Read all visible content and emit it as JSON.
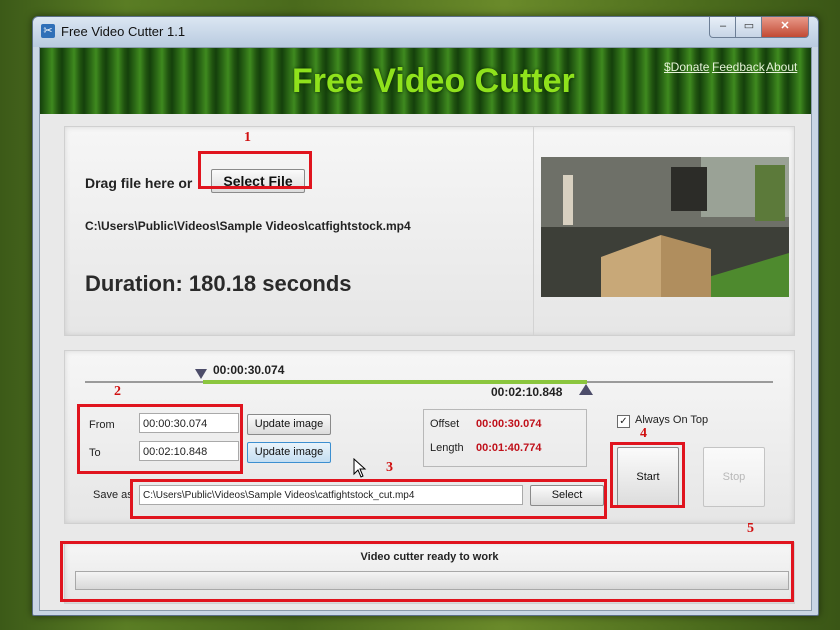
{
  "window": {
    "title": "Free Video Cutter 1.1",
    "controls": {
      "minimize": "–",
      "maximize": "▭",
      "close": "✕"
    }
  },
  "banner": {
    "title": "Free Video Cutter",
    "links": {
      "donate": "$Donate",
      "feedback": "Feedback",
      "about": "About"
    }
  },
  "file_panel": {
    "drag_label": "Drag file here or",
    "select_file_label": "Select File",
    "file_path": "C:\\Users\\Public\\Videos\\Sample Videos\\catfightstock.mp4",
    "duration_text": "Duration: 180.18 seconds"
  },
  "trim_panel": {
    "start_marker_time": "00:00:30.074",
    "end_marker_time": "00:02:10.848",
    "from_label": "From",
    "from_value": "00:00:30.074",
    "to_label": "To",
    "to_value": "00:02:10.848",
    "update_image_label": "Update image",
    "offset_label": "Offset",
    "offset_value": "00:00:30.074",
    "length_label": "Length",
    "length_value": "00:01:40.774",
    "always_on_top_label": "Always On Top",
    "always_on_top_checked": "✓",
    "save_as_label": "Save as",
    "save_as_value": "C:\\Users\\Public\\Videos\\Sample Videos\\catfightstock_cut.mp4",
    "select_label": "Select",
    "start_label": "Start",
    "stop_label": "Stop"
  },
  "status_panel": {
    "status_text": "Video cutter ready to work",
    "progress": 0
  },
  "annotations": [
    "1",
    "2",
    "3",
    "4",
    "5"
  ],
  "colors": {
    "banner_title": "#8fe21c",
    "time_value_red": "#c0101a",
    "annotation_red": "#e0141e",
    "selection_green": "#8bc63e"
  }
}
